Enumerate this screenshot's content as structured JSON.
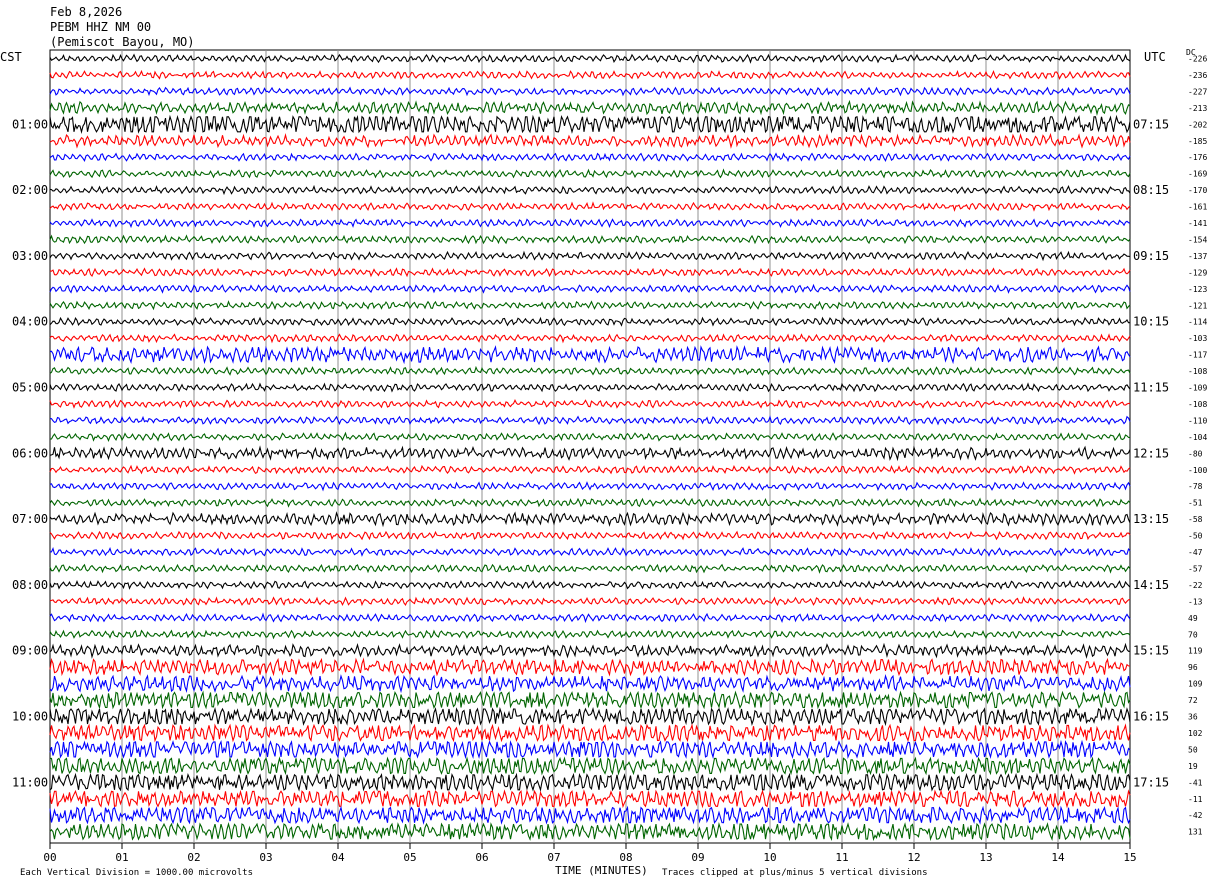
{
  "header": {
    "date": "Feb 8,2026",
    "station": "PEBM HHZ NM 00",
    "location": "(Pemiscot Bayou, MO)"
  },
  "left_axis_title": "CST",
  "right_axis_title": "UTC",
  "dc_title": "DC",
  "footer": {
    "scale_note": "Each Vertical Division = 1000.00 microvolts",
    "x_title": "TIME (MINUTES)",
    "clip_note": "Traces clipped at plus/minus 5 vertical divisions"
  },
  "colors": {
    "black": "#000000",
    "red": "#ff0000",
    "blue": "#0000ff",
    "green": "#006400",
    "grid": "#909090"
  },
  "chart_data": {
    "type": "line",
    "title": "PEBM HHZ NM 00",
    "xlabel": "TIME (MINUTES)",
    "xlim": [
      0,
      15
    ],
    "x_ticks": [
      "00",
      "01",
      "02",
      "03",
      "04",
      "05",
      "06",
      "07",
      "08",
      "09",
      "10",
      "11",
      "12",
      "13",
      "14",
      "15"
    ],
    "trace_colors_cycle": [
      "black",
      "red",
      "blue",
      "green"
    ],
    "left_time_labels": [
      "01:00",
      "02:00",
      "03:00",
      "04:00",
      "05:00",
      "06:00",
      "07:00",
      "08:00",
      "09:00",
      "10:00",
      "11:00"
    ],
    "right_time_labels": [
      "07:15",
      "08:15",
      "09:15",
      "10:15",
      "11:15",
      "12:15",
      "13:15",
      "14:15",
      "15:15",
      "16:15",
      "17:15"
    ],
    "dc_offsets": [
      -226,
      -236,
      -227,
      -213,
      -202,
      -185,
      -176,
      -169,
      -170,
      -161,
      -141,
      -154,
      -137,
      -129,
      -123,
      -121,
      -114,
      -103,
      -117,
      -108,
      -109,
      -108,
      -110,
      -104,
      -80,
      -100,
      -78,
      -51,
      -58,
      -50,
      -47,
      -57,
      -22,
      -13,
      49,
      70,
      119,
      96,
      109,
      72,
      36,
      102,
      50,
      19,
      -41,
      -11,
      -42,
      131
    ],
    "trace_activity": [
      1,
      1,
      1,
      2,
      5,
      2,
      1,
      1,
      1,
      1,
      1,
      1,
      1,
      1,
      1,
      1,
      1,
      1,
      3,
      1,
      1,
      1,
      1,
      1,
      2,
      1,
      1,
      1,
      2,
      1,
      1,
      1,
      1,
      1,
      1,
      1,
      2,
      3,
      3,
      4,
      4,
      4,
      4,
      4,
      4,
      4,
      4,
      4
    ]
  }
}
